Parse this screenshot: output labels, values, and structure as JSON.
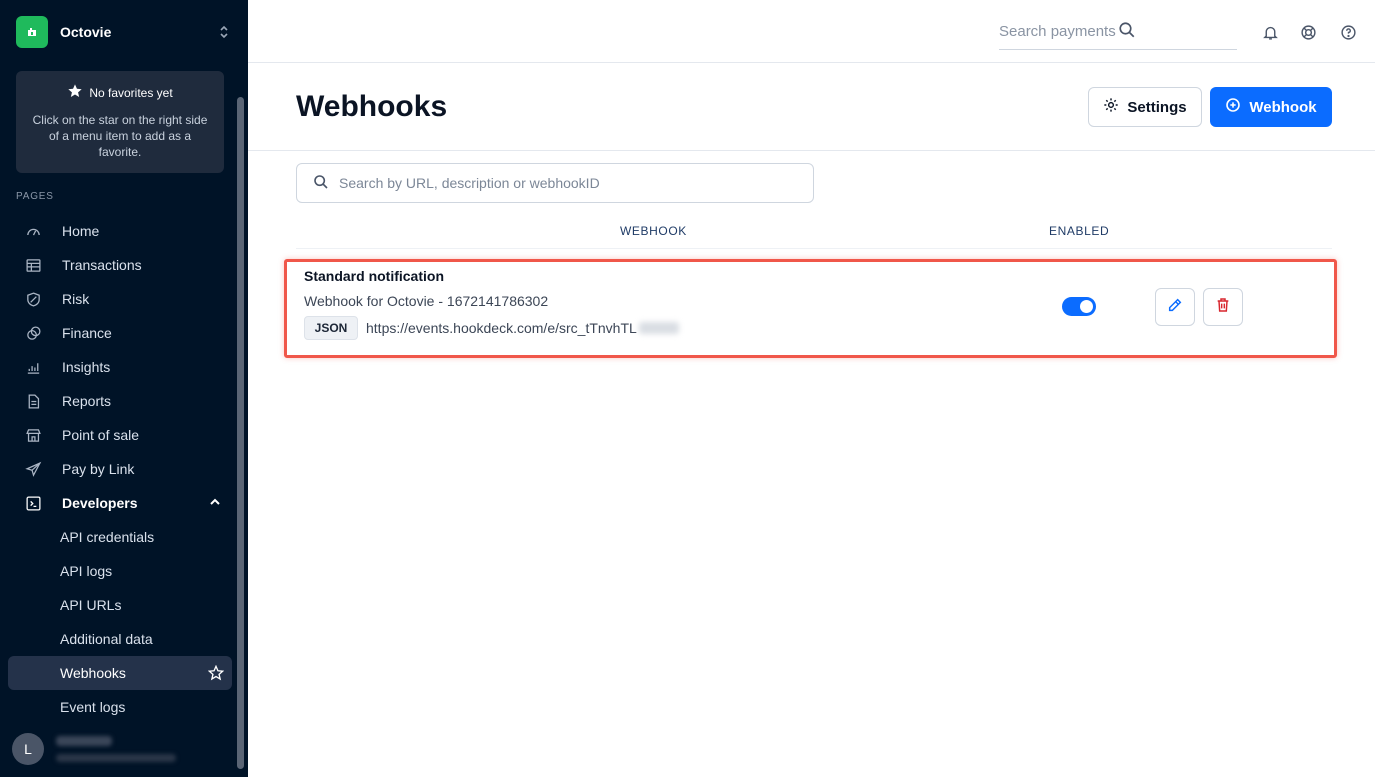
{
  "sidebar": {
    "org_name": "Octovie",
    "favorites": {
      "title": "No favorites yet",
      "description": "Click on the star on the right side of a menu item to add as a favorite."
    },
    "section_label": "PAGES",
    "items": [
      {
        "label": "Home",
        "icon": "gauge-icon"
      },
      {
        "label": "Transactions",
        "icon": "table-icon"
      },
      {
        "label": "Risk",
        "icon": "shield-icon"
      },
      {
        "label": "Finance",
        "icon": "coins-icon"
      },
      {
        "label": "Insights",
        "icon": "bar-chart-icon"
      },
      {
        "label": "Reports",
        "icon": "document-icon"
      },
      {
        "label": "Point of sale",
        "icon": "store-icon"
      },
      {
        "label": "Pay by Link",
        "icon": "paper-plane-icon"
      },
      {
        "label": "Developers",
        "icon": "terminal-icon"
      }
    ],
    "developer_subitems": [
      {
        "label": "API credentials"
      },
      {
        "label": "API logs"
      },
      {
        "label": "API URLs"
      },
      {
        "label": "Additional data"
      },
      {
        "label": "Webhooks",
        "selected": true
      },
      {
        "label": "Event logs"
      }
    ],
    "user": {
      "initial": "L"
    }
  },
  "topbar": {
    "search_placeholder": "Search payments"
  },
  "header": {
    "title": "Webhooks",
    "settings_label": "Settings",
    "webhook_label": "Webhook"
  },
  "content": {
    "search_placeholder": "Search by URL, description or webhookID",
    "columns": {
      "webhook": "WEBHOOK",
      "enabled": "ENABLED"
    },
    "webhooks": [
      {
        "name": "Standard notification",
        "description": "Webhook for Octovie - 1672141786302",
        "format": "JSON",
        "url": "https://events.hookdeck.com/e/src_tTnvhTL",
        "enabled": true
      }
    ]
  },
  "colors": {
    "sidebar_bg": "#001327",
    "accent": "#0b6cff",
    "brand": "#1fba5c",
    "highlight": "#f0574a",
    "delete": "#d8262e"
  }
}
